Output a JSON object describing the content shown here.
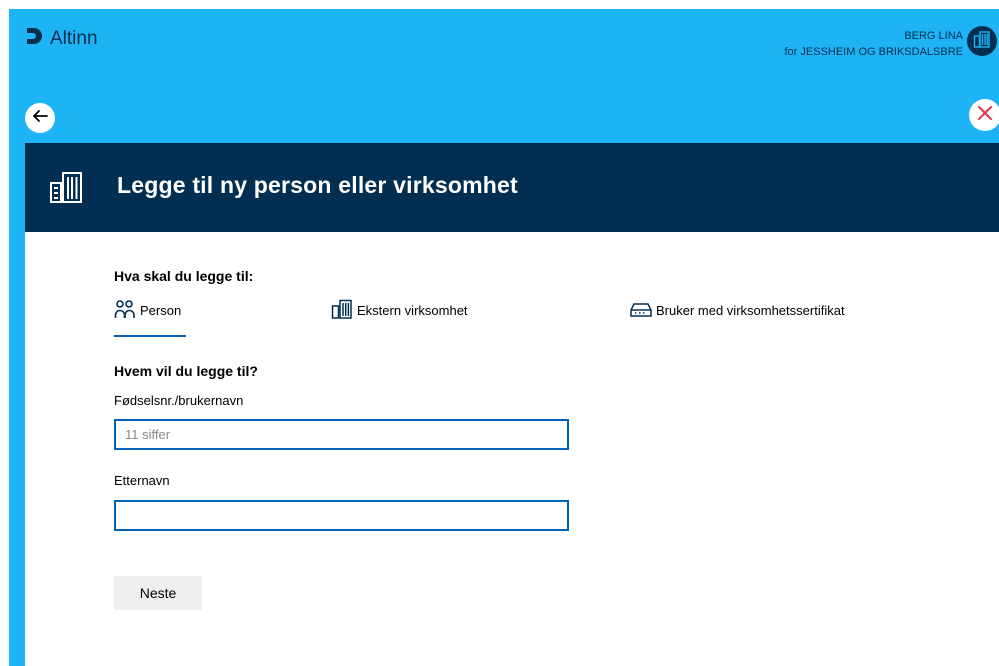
{
  "brand": {
    "name": "Altinn",
    "logo_icon": "altinn-logo-icon"
  },
  "user": {
    "name": "BERG LINA",
    "on_behalf": "for JESSHEIM OG BRIKSDALSBRE",
    "avatar_icon": "building-icon"
  },
  "nav": {
    "back_icon": "arrow-left-icon",
    "close_icon": "close-icon"
  },
  "header": {
    "title": "Legge til ny person eller virksomhet",
    "icon": "building-icon"
  },
  "form": {
    "type_question": "Hva skal du legge til:",
    "tabs": [
      {
        "label": "Person",
        "icon": "person-icon",
        "selected": true
      },
      {
        "label": "Ekstern virksomhet",
        "icon": "building-icon",
        "selected": false
      },
      {
        "label": "Bruker med virksomhetssertifikat",
        "icon": "certificate-icon",
        "selected": false
      }
    ],
    "who_question": "Hvem vil du legge til?",
    "ssn_label": "Fødselsnr./brukernavn",
    "ssn_placeholder": "11 siffer",
    "ssn_value": "",
    "lastname_label": "Etternavn",
    "lastname_value": "",
    "next_label": "Neste"
  },
  "colors": {
    "accent": "#1eb3f5",
    "dark": "#022f51",
    "focus": "#0062ba",
    "close": "#e23b53"
  }
}
